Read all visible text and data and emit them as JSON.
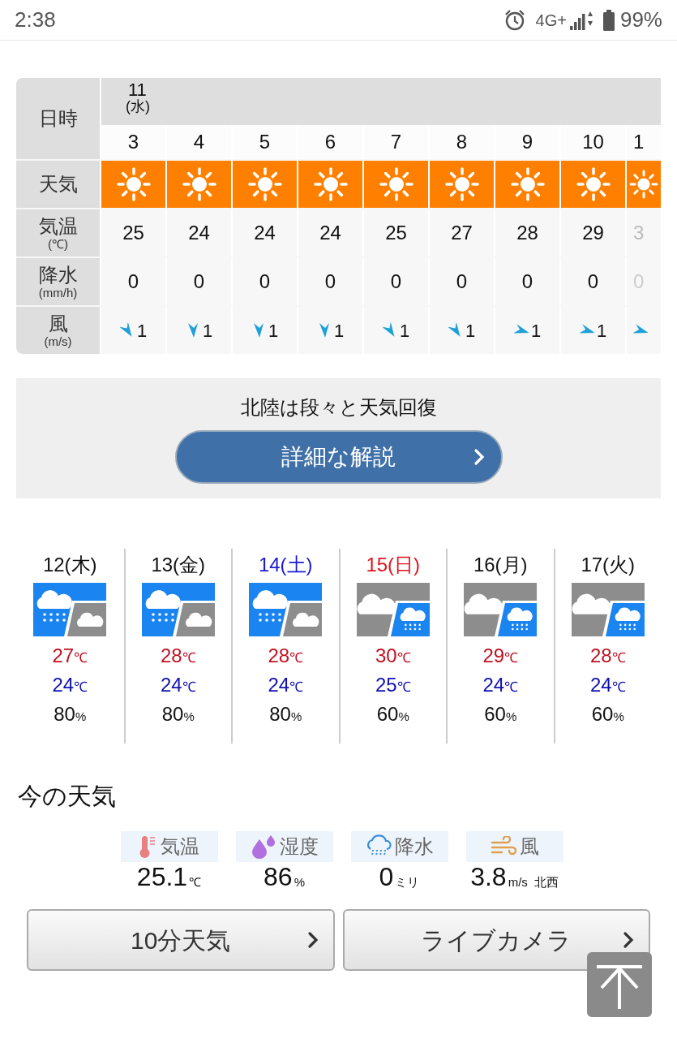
{
  "status_bar": {
    "time": "2:38",
    "network": "4G+",
    "battery": "99%"
  },
  "hourly": {
    "row_labels": [
      {
        "main": "日時"
      },
      {
        "main": "天気"
      },
      {
        "main": "気温",
        "sub": "(℃)"
      },
      {
        "main": "降水",
        "sub": "(mm/h)"
      },
      {
        "main": "風",
        "sub": "(m/s)"
      }
    ],
    "day": {
      "date": "11",
      "weekday": "(水)"
    },
    "hours": [
      {
        "hour": "3",
        "kind": "sunny",
        "temp": "25",
        "precip": "0",
        "wind": {
          "kind": "se",
          "speed": "1"
        }
      },
      {
        "hour": "4",
        "kind": "sunny",
        "temp": "24",
        "precip": "0",
        "wind": {
          "kind": "s",
          "speed": "1"
        }
      },
      {
        "hour": "5",
        "kind": "sunny",
        "temp": "24",
        "precip": "0",
        "wind": {
          "kind": "s",
          "speed": "1"
        }
      },
      {
        "hour": "6",
        "kind": "sunny",
        "temp": "24",
        "precip": "0",
        "wind": {
          "kind": "s",
          "speed": "1"
        }
      },
      {
        "hour": "7",
        "kind": "sunny",
        "temp": "25",
        "precip": "0",
        "wind": {
          "kind": "se",
          "speed": "1"
        }
      },
      {
        "hour": "8",
        "kind": "sunny",
        "temp": "27",
        "precip": "0",
        "wind": {
          "kind": "se",
          "speed": "1"
        }
      },
      {
        "hour": "9",
        "kind": "sunny",
        "temp": "28",
        "precip": "0",
        "wind": {
          "kind": "e",
          "speed": "1"
        }
      },
      {
        "hour": "10",
        "kind": "sunny",
        "temp": "29",
        "precip": "0",
        "wind": {
          "kind": "e",
          "speed": "1"
        }
      },
      {
        "hour": "1",
        "kind": "sunny",
        "temp": "3",
        "precip": "0",
        "wind": {
          "kind": "e"
        }
      }
    ]
  },
  "commentary": {
    "headline": "北陸は段々と天気回復",
    "button": "詳細な解説"
  },
  "weekly": [
    {
      "date": "12",
      "weekday": "(木)",
      "color": "#111111",
      "kind": "rain_then_cloudy",
      "high": "27",
      "low": "24",
      "unit": "℃",
      "pop": "80",
      "pop_unit": "%"
    },
    {
      "date": "13",
      "weekday": "(金)",
      "color": "#111111",
      "kind": "rain_then_cloudy",
      "high": "28",
      "low": "24",
      "unit": "℃",
      "pop": "80",
      "pop_unit": "%"
    },
    {
      "date": "14",
      "weekday": "(土)",
      "color": "#1a1ad0",
      "kind": "rain_then_cloudy",
      "high": "28",
      "low": "24",
      "unit": "℃",
      "pop": "80",
      "pop_unit": "%"
    },
    {
      "date": "15",
      "weekday": "(日)",
      "color": "#e0141e",
      "kind": "cloudy_then_rain",
      "high": "30",
      "low": "25",
      "unit": "℃",
      "pop": "60",
      "pop_unit": "%"
    },
    {
      "date": "16",
      "weekday": "(月)",
      "color": "#111111",
      "kind": "cloudy_then_rain",
      "high": "29",
      "low": "24",
      "unit": "℃",
      "pop": "60",
      "pop_unit": "%"
    },
    {
      "date": "17",
      "weekday": "(火)",
      "color": "#111111",
      "kind": "cloudy_then_rain",
      "high": "28",
      "low": "24",
      "unit": "℃",
      "pop": "60",
      "pop_unit": "%"
    }
  ],
  "current": {
    "title": "今の天気",
    "items": [
      {
        "kind": "temperature",
        "label": "気温",
        "value": "25.1",
        "unit": "℃"
      },
      {
        "kind": "humidity",
        "label": "湿度",
        "value": "86",
        "unit": "%"
      },
      {
        "kind": "precipitation",
        "label": "降水",
        "value": "0",
        "unit": "ミリ"
      },
      {
        "kind": "wind",
        "label": "風",
        "value": "3.8",
        "unit": "m/s",
        "extra": "北西"
      }
    ]
  },
  "links": [
    "10分天気",
    "ライブカメラ"
  ]
}
